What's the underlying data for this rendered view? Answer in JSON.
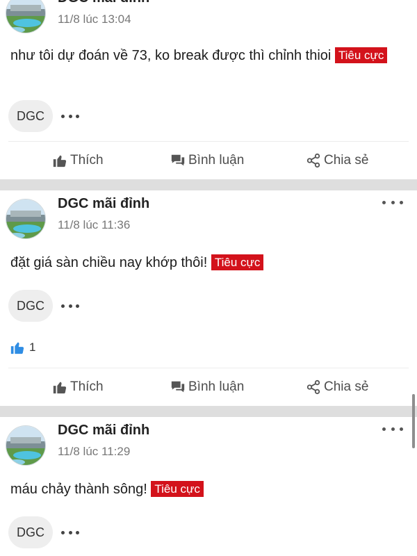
{
  "posts": [
    {
      "author": "DGC mãi đỉnh",
      "time": "11/8 lúc 13:04",
      "text": "như tôi dự đoán về 73, ko break được thì chỉnh thioi",
      "sentiment_tag": "Tiêu cực",
      "stock_tag": "DGC",
      "likes": null
    },
    {
      "author": "DGC mãi đỉnh",
      "time": "11/8 lúc 11:36",
      "text": "đặt giá sàn chiều nay khớp thôi!",
      "sentiment_tag": "Tiêu cực",
      "stock_tag": "DGC",
      "likes": "1"
    },
    {
      "author": "DGC mãi đỉnh",
      "time": "11/8 lúc 11:29",
      "text": "máu chảy thành sông!",
      "sentiment_tag": "Tiêu cực",
      "stock_tag": "DGC",
      "likes": null
    }
  ],
  "actions": {
    "like_label": "Thích",
    "comment_label": "Bình luận",
    "share_label": "Chia sẻ"
  },
  "colors": {
    "tag_background": "#d3121b",
    "like_count_icon": "#2f8de4",
    "separator": "#dedede"
  },
  "icons": {
    "more": "more-horizontal-icon",
    "like": "thumbs-up-icon",
    "comment": "comment-bubbles-icon",
    "share": "share-nodes-icon",
    "like_count": "blue-thumbs-up-icon"
  }
}
